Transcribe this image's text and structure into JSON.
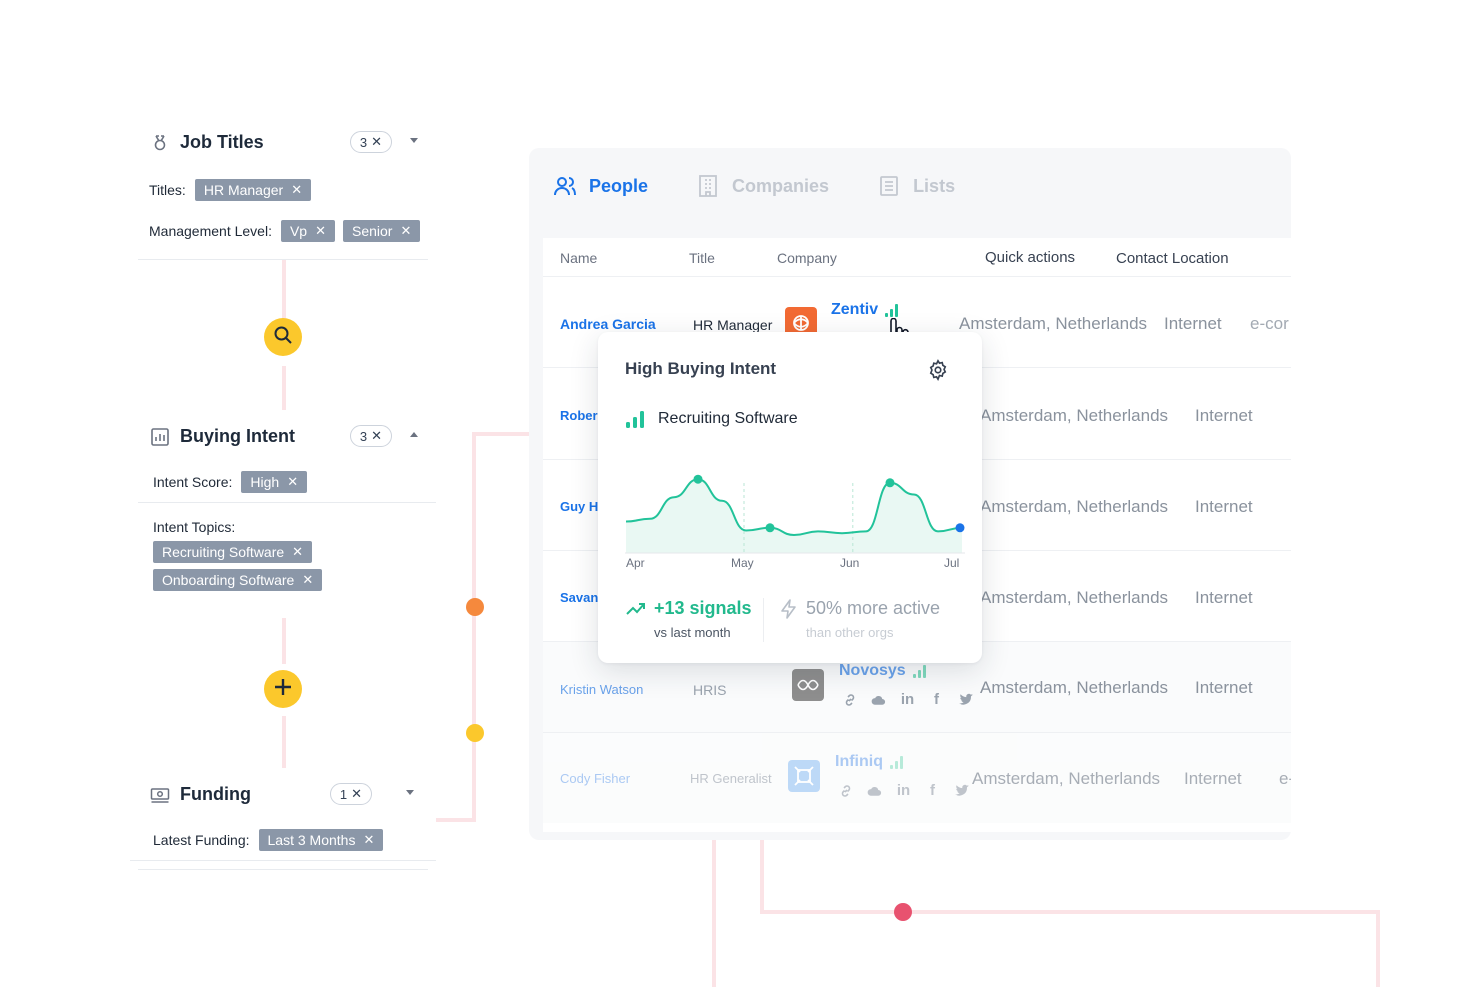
{
  "filters": {
    "job_titles": {
      "title": "Job Titles",
      "count": "3",
      "titles_label": "Titles:",
      "titles": [
        "HR Manager"
      ],
      "mgmt_label": "Management Level:",
      "mgmt_levels": [
        "Vp",
        "Senior"
      ]
    },
    "buying_intent": {
      "title": "Buying Intent",
      "count": "3",
      "score_label": "Intent Score:",
      "score": "High",
      "topics_label": "Intent Topics:",
      "topics": [
        "Recruiting Software",
        "Onboarding Software"
      ]
    },
    "funding": {
      "title": "Funding",
      "count": "1",
      "latest_label": "Latest Funding:",
      "latest": "Last 3 Months"
    },
    "remove_glyph": "✕"
  },
  "tabs": {
    "people": "People",
    "companies": "Companies",
    "lists": "Lists"
  },
  "table": {
    "headers": {
      "name": "Name",
      "title": "Title",
      "company": "Company",
      "quick_actions": "Quick actions",
      "contact_location": "Contact Location"
    },
    "rows": [
      {
        "name": "Andrea Garcia",
        "title": "HR Manager",
        "company": "Zentiv",
        "location": "Amsterdam, Netherlands",
        "industry": "Internet",
        "extra": "e-cor"
      },
      {
        "name": "Rober",
        "title": "",
        "company": "",
        "location": "Amsterdam, Netherlands",
        "industry": "Internet",
        "extra": ""
      },
      {
        "name": "Guy H",
        "title": "",
        "company": "",
        "location": "Amsterdam, Netherlands",
        "industry": "Internet",
        "extra": ""
      },
      {
        "name": "Savan",
        "title": "",
        "company": "",
        "location": "Amsterdam, Netherlands",
        "industry": "Internet",
        "extra": ""
      },
      {
        "name": "Kristin Watson",
        "title": "HRIS",
        "company": "Novosys",
        "location": "Amsterdam, Netherlands",
        "industry": "Internet",
        "extra": ""
      },
      {
        "name": "Cody Fisher",
        "title": "HR Generalist",
        "company": "Infiniq",
        "location": "Amsterdam, Netherlands",
        "industry": "Internet",
        "extra": "e-"
      }
    ]
  },
  "popover": {
    "title": "High Buying Intent",
    "topic": "Recruiting Software",
    "signals": "+13 signals",
    "signals_sub": "vs last month",
    "activity": "50% more active",
    "activity_sub": "than other orgs"
  },
  "chart_data": {
    "type": "area",
    "x_tick_labels": [
      "Apr",
      "May",
      "Jun",
      "Jul"
    ],
    "series": [
      {
        "values": [
          0.35,
          0.38,
          0.62,
          0.82,
          0.58,
          0.25,
          0.28,
          0.2,
          0.24,
          0.22,
          0.24,
          0.78,
          0.65,
          0.24,
          0.28
        ]
      }
    ],
    "highlighted_points": [
      0.82,
      0.28,
      0.78,
      0.28
    ],
    "ylim": [
      0,
      1
    ],
    "grid": false,
    "colors": {
      "line": "#22c39a",
      "fill": "#e9f8f3",
      "last_point": "#1a73e8"
    }
  },
  "colors": {
    "accent": "#1a73e8",
    "tag": "#8b97a8",
    "action": "#fbc82c",
    "positive": "#22b98d",
    "connector": "#fbe3e6",
    "dot_orange": "#f5893d",
    "dot_yellow": "#fbc82c",
    "dot_red": "#e8526f",
    "zentiv_logo": "#f26a33",
    "novosys_logo": "#8e8e8e",
    "infiniq_logo": "#a8cdf5"
  },
  "icons": {
    "job_titles": "badge-icon",
    "buying_intent": "bar-chart-icon",
    "funding": "money-icon",
    "search": "search-icon",
    "add": "plus-icon",
    "people": "people-icon",
    "companies": "building-icon",
    "lists": "list-icon",
    "gear": "gear-icon",
    "cursor": "hand-pointer-icon",
    "trend": "trend-up-icon",
    "bolt": "lightning-icon"
  }
}
